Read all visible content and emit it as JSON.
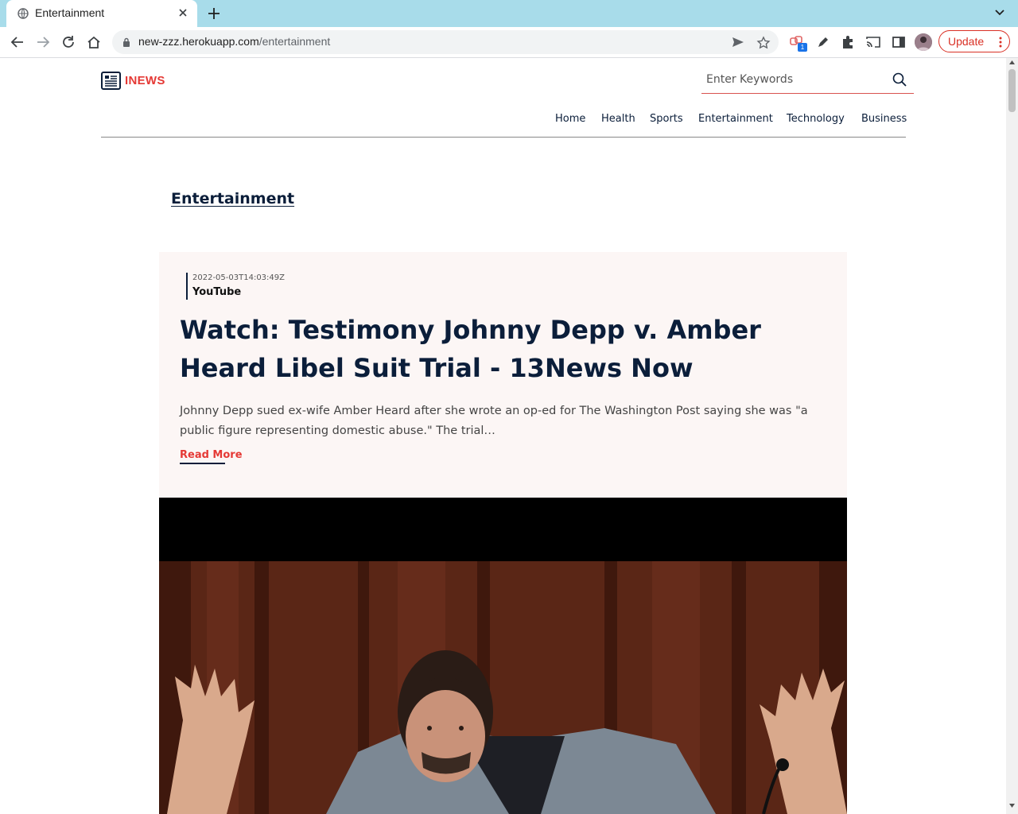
{
  "browser": {
    "tab_title": "Entertainment",
    "url_host": "new-zzz.herokuapp.com",
    "url_path": "/entertainment",
    "extension_badge": "1",
    "update_label": "Update"
  },
  "site": {
    "brand": "INEWS",
    "search_placeholder": "Enter Keywords",
    "nav": [
      "Home",
      "Health",
      "Sports",
      "Entertainment",
      "Technology",
      "Business"
    ]
  },
  "page": {
    "section_title": "Entertainment"
  },
  "article": {
    "date": "2022-05-03T14:03:49Z",
    "source": "YouTube",
    "headline": "Watch: Testimony Johnny Depp v. Amber Heard Libel Suit Trial - 13News Now",
    "excerpt": "Johnny Depp sued ex-wife Amber Heard after she wrote an op-ed for The Washington Post saying she was \"a public figure representing domestic abuse.\" The trial…",
    "read_more": "Read More"
  },
  "colors": {
    "accent": "#e53935",
    "navy": "#0b1e3a",
    "card_bg": "#fcf6f5",
    "tabbar": "#a8dcea"
  }
}
